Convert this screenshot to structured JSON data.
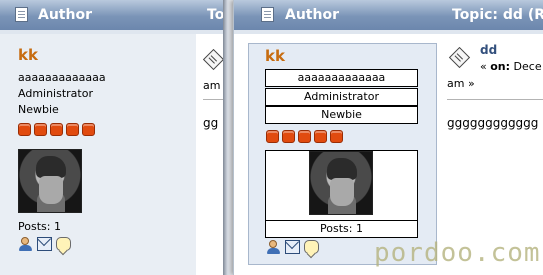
{
  "left": {
    "header": {
      "author_label": "Author",
      "topic_label": "To"
    },
    "poster": {
      "username": "kk",
      "usertext": "aaaaaaaaaaaaa",
      "role": "Administrator",
      "rank": "Newbie",
      "stars": 5,
      "posts": "Posts: 1"
    },
    "message": {
      "meta_fragment": "am",
      "body_fragment": "gg"
    }
  },
  "right": {
    "header": {
      "author_label": "Author",
      "topic_label": "Topic: dd  (Re"
    },
    "poster": {
      "username": "kk",
      "usertext": "aaaaaaaaaaaaa",
      "role": "Administrator",
      "rank": "Newbie",
      "stars": 5,
      "posts": "Posts: 1"
    },
    "message": {
      "subject": "dd",
      "meta_prefix": "« ",
      "meta_on": "on:",
      "meta_date": " Dece",
      "meta_line2": "am »",
      "body": "gggggggggggg"
    }
  },
  "watermark": "pordoo.com",
  "colors": {
    "header_blue": "#7a94b7",
    "username_orange": "#c76c10",
    "star_red": "#e14b0f"
  },
  "icons": [
    "document-icon",
    "message-icon",
    "profile-icon",
    "email-icon",
    "pm-icon"
  ]
}
